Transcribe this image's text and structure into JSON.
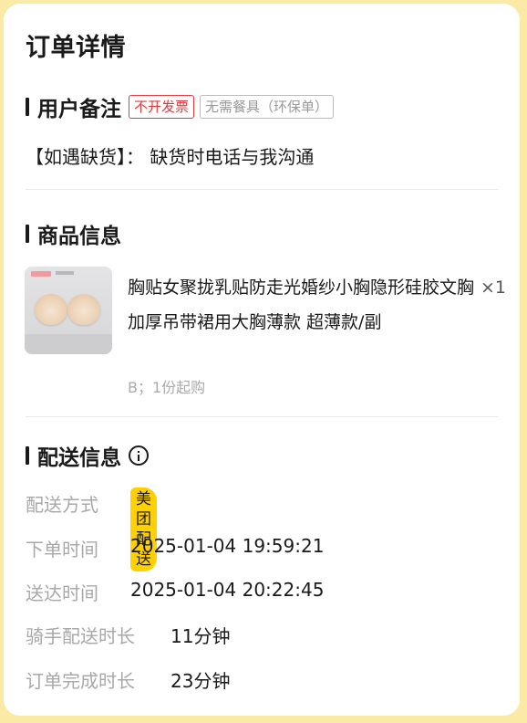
{
  "page": {
    "title": "订单详情"
  },
  "user_remark": {
    "title": "用户备注",
    "tags": [
      "不开发票",
      "无需餐具（环保单）"
    ],
    "remark_text": "【如遇缺货】： 缺货时电话与我沟通"
  },
  "product_info": {
    "title": "商品信息",
    "items": [
      {
        "name": "胸贴女聚拢乳贴防走光婚纱小胸隐形硅胶文胸加厚吊带裙用大胸薄款 超薄款/副",
        "quantity": "×1",
        "spec": "B；1份起购",
        "image_icon": "product-image"
      }
    ]
  },
  "delivery_info": {
    "title": "配送信息",
    "info_icon": "info-icon",
    "rows": [
      {
        "label": "配送方式",
        "value": "美团配送"
      },
      {
        "label": "下单时间",
        "value": "2025-01-04 19:59:21"
      },
      {
        "label": "送达时间",
        "value": "2025-01-04 20:22:45"
      },
      {
        "label": "骑手配送时长",
        "value": "11分钟"
      },
      {
        "label": "订单完成时长",
        "value": "23分钟"
      }
    ]
  },
  "colors": {
    "background": "#fbe9a6",
    "accent_yellow": "#ffd100",
    "tag_red": "#e23a3a",
    "label_gray": "#a8a8a8"
  }
}
